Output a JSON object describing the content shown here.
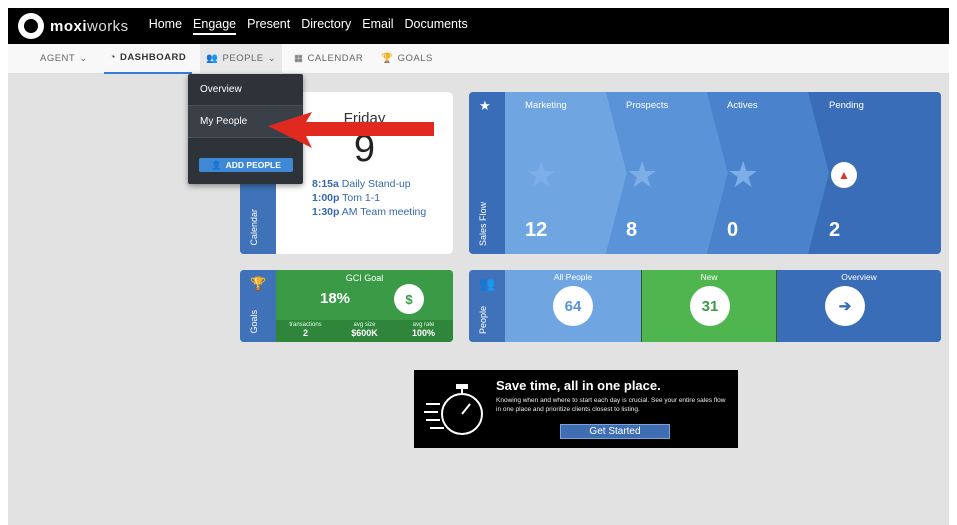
{
  "logo": {
    "bold": "moxi",
    "light": "works"
  },
  "topnav": [
    "Home",
    "Engage",
    "Present",
    "Directory",
    "Email",
    "Documents"
  ],
  "subnav": {
    "agent": "AGENT",
    "dashboard": "DASHBOARD",
    "people": "PEOPLE",
    "calendar": "CALENDAR",
    "goals": "GOALS"
  },
  "people_menu": {
    "overview": "Overview",
    "my_people": "My People",
    "add_people": "ADD PEOPLE"
  },
  "calendar": {
    "side_label": "Calendar",
    "day_name": "Friday",
    "day_num": "9",
    "events": [
      {
        "time": "8:15a",
        "title": "Daily Stand-up"
      },
      {
        "time": "1:00p",
        "title": "Tom 1-1"
      },
      {
        "time": "1:30p",
        "title": "AM Team meeting"
      }
    ]
  },
  "sales_flow": {
    "side_label": "Sales Flow",
    "stages": [
      {
        "label": "Marketing",
        "count": "12"
      },
      {
        "label": "Prospects",
        "count": "8"
      },
      {
        "label": "Actives",
        "count": "0"
      },
      {
        "label": "Pending",
        "count": "2"
      }
    ]
  },
  "goals": {
    "side_label": "Goals",
    "title": "GCI Goal",
    "percent": "18%",
    "stats": [
      {
        "key": "transactions",
        "value": "2"
      },
      {
        "key": "avg size",
        "value": "$600K"
      },
      {
        "key": "avg rate",
        "value": "100%"
      }
    ]
  },
  "people": {
    "side_label": "People",
    "cols": [
      {
        "label": "All People",
        "value": "64"
      },
      {
        "label": "New",
        "value": "31"
      },
      {
        "label": "Overview",
        "value": "➔"
      }
    ]
  },
  "promo": {
    "headline": "Save time, all in one place.",
    "body": "Knowing when and where to start each day is crucial. See your entire sales flow in one place and prioritize clients closest to listing.",
    "button": "Get Started"
  },
  "colors": {
    "accent": "#3f72b8",
    "green": "#3a9a45",
    "arrow": "#e02a1f"
  }
}
